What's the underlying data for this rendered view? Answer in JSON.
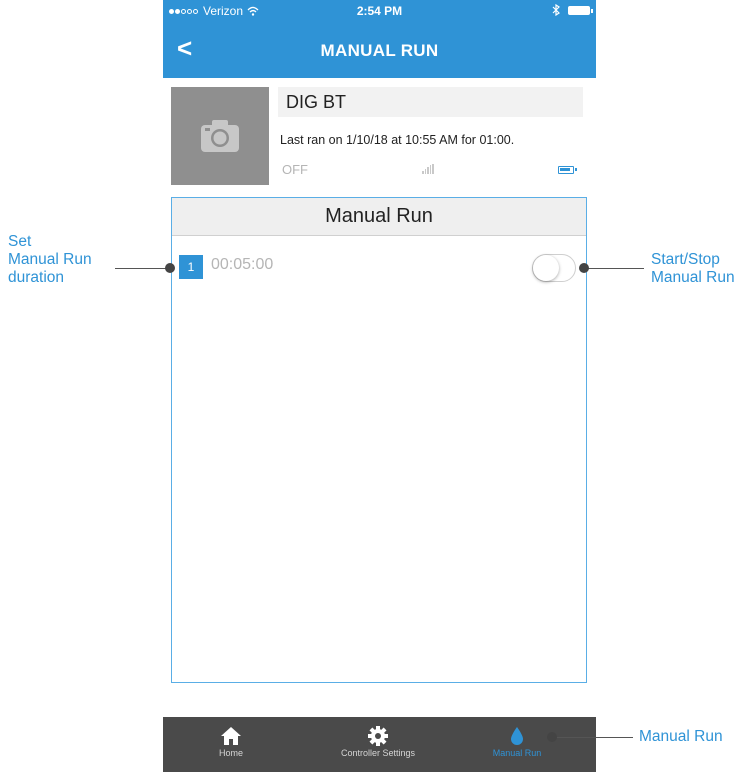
{
  "status_bar": {
    "carrier": "Verizon",
    "time": "2:54 PM",
    "bluetooth": "bluetooth-icon"
  },
  "nav": {
    "title": "MANUAL RUN",
    "back_icon": "<"
  },
  "controller": {
    "name": "DIG BT",
    "last_ran": "Last ran on 1/10/18 at 10:55 AM for 01:00.",
    "state": "OFF"
  },
  "manual_run": {
    "header": "Manual Run",
    "zones": [
      {
        "number": "1",
        "duration": "00:05:00",
        "enabled": false
      }
    ]
  },
  "tab_bar": {
    "tabs": [
      {
        "label": "Home",
        "icon": "home-icon"
      },
      {
        "label": "Controller Settings",
        "icon": "gear-icon"
      },
      {
        "label": "Manual Run",
        "icon": "water-drop-icon",
        "active": true
      }
    ]
  },
  "annotations": {
    "left": [
      "Set",
      "Manual Run",
      "duration"
    ],
    "right": [
      "Start/Stop",
      "Manual Run"
    ],
    "bottom": "Manual Run"
  },
  "colors": {
    "accent": "#2f93d6",
    "tab_bar": "#4a4a4a",
    "photo_bg": "#8f8f8f"
  }
}
